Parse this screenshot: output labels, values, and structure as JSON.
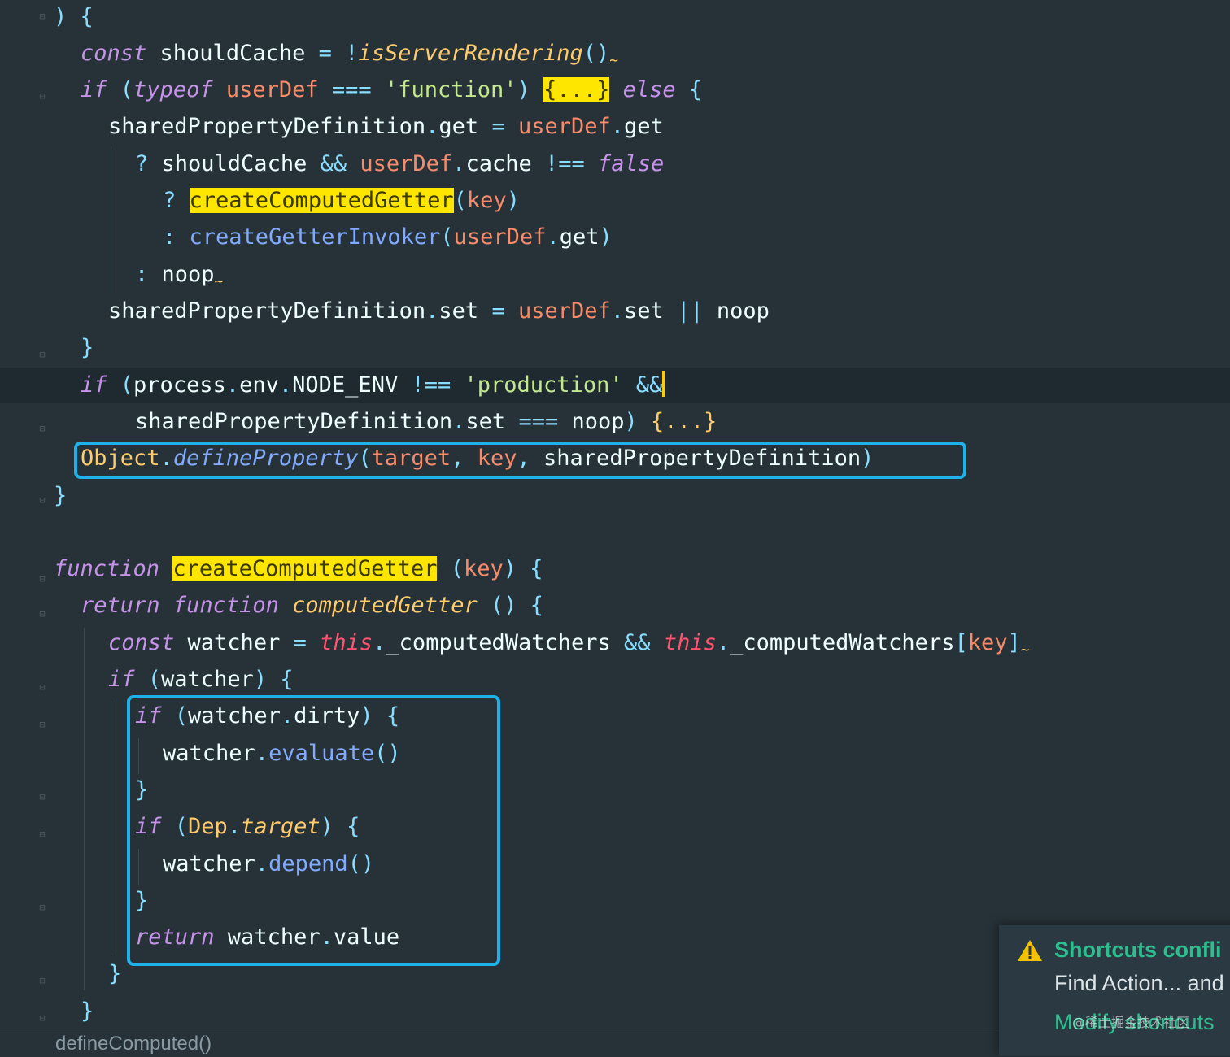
{
  "editor": {
    "lines": [
      {
        "segments": [
          {
            "t": ") ",
            "c": "br"
          },
          {
            "t": "{",
            "c": "br"
          }
        ]
      },
      {
        "segments": [
          {
            "t": "const",
            "c": "kw"
          },
          {
            "t": " shouldCache "
          },
          {
            "t": "=",
            "c": "op"
          },
          {
            "t": " "
          },
          {
            "t": "!",
            "c": "op"
          },
          {
            "t": "isServerRendering",
            "c": "par"
          },
          {
            "t": "()",
            "c": "br"
          },
          {
            "t": "~",
            "c": "sq"
          }
        ]
      },
      {
        "segments": [
          {
            "t": "if",
            "c": "kw"
          },
          {
            "t": " "
          },
          {
            "t": "(",
            "c": "br"
          },
          {
            "t": "typeof",
            "c": "kw"
          },
          {
            "t": " "
          },
          {
            "t": "userDef",
            "c": "var"
          },
          {
            "t": " "
          },
          {
            "t": "===",
            "c": "op"
          },
          {
            "t": " "
          },
          {
            "t": "'function'",
            "c": "str"
          },
          {
            "t": ")",
            "c": "br"
          },
          {
            "t": " "
          },
          {
            "t": "{...}",
            "c": "hl"
          },
          {
            "t": " "
          },
          {
            "t": "else",
            "c": "kw"
          },
          {
            "t": " "
          },
          {
            "t": "{",
            "c": "br"
          }
        ]
      },
      {
        "segments": [
          {
            "t": "sharedPropertyDefinition"
          },
          {
            "t": ".",
            "c": "op"
          },
          {
            "t": "get "
          },
          {
            "t": "=",
            "c": "op"
          },
          {
            "t": " "
          },
          {
            "t": "userDef",
            "c": "var"
          },
          {
            "t": ".",
            "c": "op"
          },
          {
            "t": "get"
          }
        ]
      },
      {
        "segments": [
          {
            "t": "?",
            "c": "op"
          },
          {
            "t": " shouldCache "
          },
          {
            "t": "&&",
            "c": "op"
          },
          {
            "t": " "
          },
          {
            "t": "userDef",
            "c": "var"
          },
          {
            "t": ".",
            "c": "op"
          },
          {
            "t": "cache "
          },
          {
            "t": "!==",
            "c": "op"
          },
          {
            "t": " "
          },
          {
            "t": "false",
            "c": "kw"
          }
        ]
      },
      {
        "segments": [
          {
            "t": "?",
            "c": "op"
          },
          {
            "t": " "
          },
          {
            "t": "createComputedGetter",
            "c": "hl"
          },
          {
            "t": "(",
            "c": "br"
          },
          {
            "t": "key",
            "c": "var"
          },
          {
            "t": ")",
            "c": "br"
          }
        ]
      },
      {
        "segments": [
          {
            "t": ":",
            "c": "op"
          },
          {
            "t": " "
          },
          {
            "t": "createGetterInvoker",
            "c": "fn"
          },
          {
            "t": "(",
            "c": "br"
          },
          {
            "t": "userDef",
            "c": "var"
          },
          {
            "t": ".",
            "c": "op"
          },
          {
            "t": "get"
          },
          {
            "t": ")",
            "c": "br"
          }
        ]
      },
      {
        "segments": [
          {
            "t": ":",
            "c": "op"
          },
          {
            "t": " noop"
          },
          {
            "t": "~",
            "c": "sq"
          }
        ]
      },
      {
        "segments": [
          {
            "t": "sharedPropertyDefinition"
          },
          {
            "t": ".",
            "c": "op"
          },
          {
            "t": "set "
          },
          {
            "t": "=",
            "c": "op"
          },
          {
            "t": " "
          },
          {
            "t": "userDef",
            "c": "var"
          },
          {
            "t": ".",
            "c": "op"
          },
          {
            "t": "set "
          },
          {
            "t": "||",
            "c": "op"
          },
          {
            "t": " noop"
          }
        ]
      },
      {
        "segments": [
          {
            "t": "}",
            "c": "br"
          }
        ]
      },
      {
        "segments": [
          {
            "t": "if",
            "c": "kw"
          },
          {
            "t": " "
          },
          {
            "t": "(",
            "c": "br"
          },
          {
            "t": "process"
          },
          {
            "t": ".",
            "c": "op"
          },
          {
            "t": "env"
          },
          {
            "t": ".",
            "c": "op"
          },
          {
            "t": "NODE_ENV "
          },
          {
            "t": "!==",
            "c": "op"
          },
          {
            "t": " "
          },
          {
            "t": "'production'",
            "c": "str"
          },
          {
            "t": " "
          },
          {
            "t": "&&",
            "c": "op"
          }
        ]
      },
      {
        "segments": [
          {
            "t": "sharedPropertyDefinition"
          },
          {
            "t": ".",
            "c": "op"
          },
          {
            "t": "set "
          },
          {
            "t": "===",
            "c": "op"
          },
          {
            "t": " noop"
          },
          {
            "t": ")",
            "c": "br"
          },
          {
            "t": " "
          },
          {
            "t": "{...}",
            "c": "cls"
          }
        ]
      },
      {
        "segments": [
          {
            "t": "Object",
            "c": "cls"
          },
          {
            "t": ".",
            "c": "op"
          },
          {
            "t": "defineProperty",
            "c": "fni"
          },
          {
            "t": "(",
            "c": "br"
          },
          {
            "t": "target",
            "c": "var"
          },
          {
            "t": ",",
            "c": "op"
          },
          {
            "t": " "
          },
          {
            "t": "key",
            "c": "var"
          },
          {
            "t": ",",
            "c": "op"
          },
          {
            "t": " sharedPropertyDefinition"
          },
          {
            "t": ")",
            "c": "br"
          }
        ]
      },
      {
        "segments": [
          {
            "t": "}",
            "c": "br"
          }
        ]
      },
      {
        "segments": []
      },
      {
        "segments": [
          {
            "t": "function",
            "c": "kw"
          },
          {
            "t": " "
          },
          {
            "t": "createComputedGetter",
            "c": "hl"
          },
          {
            "t": " "
          },
          {
            "t": "(",
            "c": "br"
          },
          {
            "t": "key",
            "c": "var"
          },
          {
            "t": ")",
            "c": "br"
          },
          {
            "t": " "
          },
          {
            "t": "{",
            "c": "br"
          }
        ]
      },
      {
        "segments": [
          {
            "t": "return",
            "c": "kw"
          },
          {
            "t": " "
          },
          {
            "t": "function",
            "c": "kw"
          },
          {
            "t": " "
          },
          {
            "t": "computedGetter",
            "c": "par"
          },
          {
            "t": " "
          },
          {
            "t": "()",
            "c": "br"
          },
          {
            "t": " "
          },
          {
            "t": "{",
            "c": "br"
          }
        ]
      },
      {
        "segments": [
          {
            "t": "const",
            "c": "kw"
          },
          {
            "t": " watcher "
          },
          {
            "t": "=",
            "c": "op"
          },
          {
            "t": " "
          },
          {
            "t": "this",
            "c": "th"
          },
          {
            "t": ".",
            "c": "op"
          },
          {
            "t": "_computedWatchers "
          },
          {
            "t": "&&",
            "c": "op"
          },
          {
            "t": " "
          },
          {
            "t": "this",
            "c": "th"
          },
          {
            "t": ".",
            "c": "op"
          },
          {
            "t": "_computedWatchers"
          },
          {
            "t": "[",
            "c": "br"
          },
          {
            "t": "key",
            "c": "var"
          },
          {
            "t": "]",
            "c": "br"
          },
          {
            "t": "~",
            "c": "sq"
          }
        ]
      },
      {
        "segments": [
          {
            "t": "if",
            "c": "kw"
          },
          {
            "t": " "
          },
          {
            "t": "(",
            "c": "br"
          },
          {
            "t": "watcher"
          },
          {
            "t": ")",
            "c": "br"
          },
          {
            "t": " "
          },
          {
            "t": "{",
            "c": "br"
          }
        ]
      },
      {
        "segments": [
          {
            "t": "if",
            "c": "kw"
          },
          {
            "t": " "
          },
          {
            "t": "(",
            "c": "br"
          },
          {
            "t": "watcher"
          },
          {
            "t": ".",
            "c": "op"
          },
          {
            "t": "dirty"
          },
          {
            "t": ")",
            "c": "br"
          },
          {
            "t": " "
          },
          {
            "t": "{",
            "c": "br"
          }
        ]
      },
      {
        "segments": [
          {
            "t": "watcher"
          },
          {
            "t": ".",
            "c": "op"
          },
          {
            "t": "evaluate",
            "c": "fn"
          },
          {
            "t": "()",
            "c": "br"
          }
        ]
      },
      {
        "segments": [
          {
            "t": "}",
            "c": "br"
          }
        ]
      },
      {
        "segments": [
          {
            "t": "if",
            "c": "kw"
          },
          {
            "t": " "
          },
          {
            "t": "(",
            "c": "br"
          },
          {
            "t": "Dep",
            "c": "cls"
          },
          {
            "t": ".",
            "c": "op"
          },
          {
            "t": "target",
            "c": "par"
          },
          {
            "t": ")",
            "c": "br"
          },
          {
            "t": " "
          },
          {
            "t": "{",
            "c": "br"
          }
        ]
      },
      {
        "segments": [
          {
            "t": "watcher"
          },
          {
            "t": ".",
            "c": "op"
          },
          {
            "t": "depend",
            "c": "fn"
          },
          {
            "t": "()",
            "c": "br"
          }
        ]
      },
      {
        "segments": [
          {
            "t": "}",
            "c": "br"
          }
        ]
      },
      {
        "segments": [
          {
            "t": "return",
            "c": "kw"
          },
          {
            "t": " watcher"
          },
          {
            "t": ".",
            "c": "op"
          },
          {
            "t": "value"
          }
        ]
      },
      {
        "segments": [
          {
            "t": "}",
            "c": "br"
          }
        ]
      },
      {
        "segments": [
          {
            "t": "}",
            "c": "br"
          }
        ]
      }
    ],
    "cursor_line": 10
  },
  "breadcrumb": "defineComputed()",
  "notification": {
    "title": "Shortcuts confli",
    "body": "Find Action... and",
    "link": "Modify shortcuts"
  },
  "watermark": "@稀土掘金技术社区",
  "colors": {
    "background": "#263238",
    "keyword": "#c792ea",
    "string": "#c3e88d",
    "highlight": "#ffe600",
    "box_outline": "#1eb1ea",
    "notification_accent": "#2dbd8f"
  }
}
